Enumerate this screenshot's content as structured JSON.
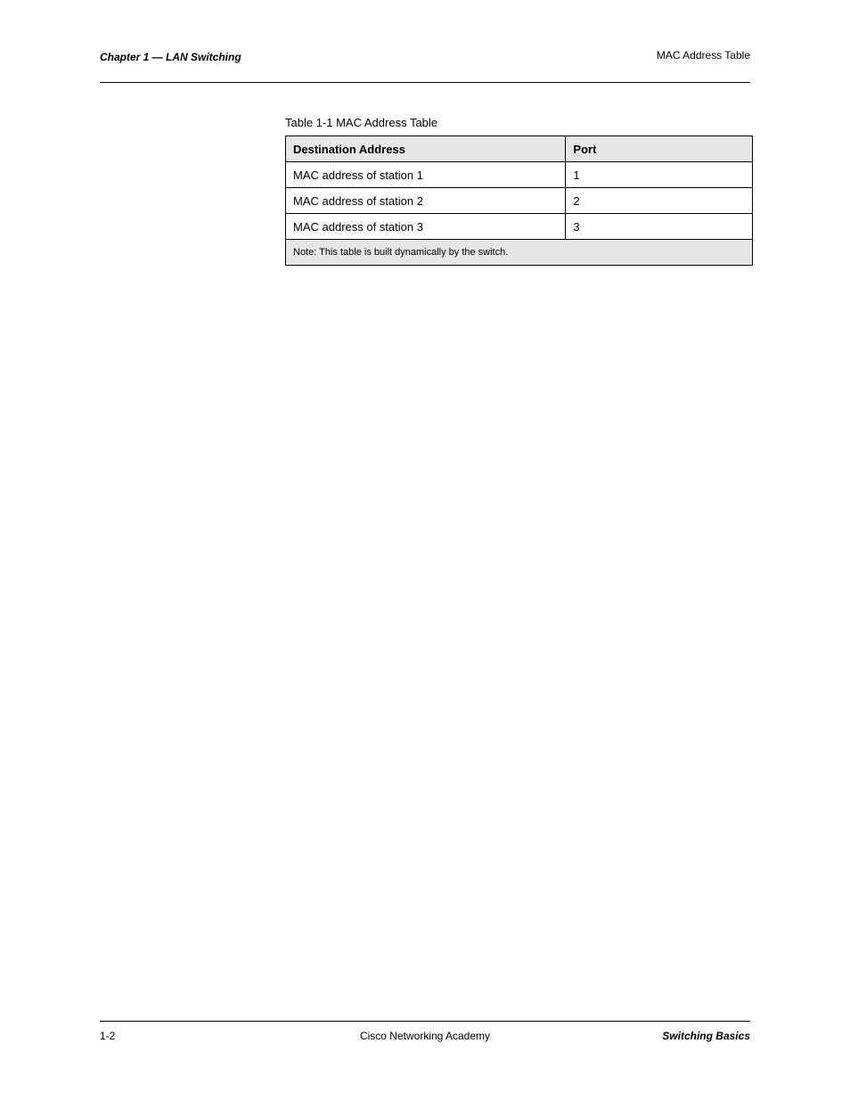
{
  "header": {
    "left": "Chapter 1 — LAN Switching",
    "right": "MAC Address Table"
  },
  "table": {
    "caption": "Table 1-1   MAC Address Table",
    "headers": [
      "Destination Address",
      "Port"
    ],
    "rows": [
      [
        "MAC address of station 1",
        "1"
      ],
      [
        "MAC address of station 2",
        "2"
      ],
      [
        "MAC address of station 3",
        "3"
      ]
    ],
    "footnote": "Note: This table is built dynamically by the switch."
  },
  "footer": {
    "left": "1-2",
    "center": "Cisco Networking Academy",
    "right": "Switching Basics"
  }
}
